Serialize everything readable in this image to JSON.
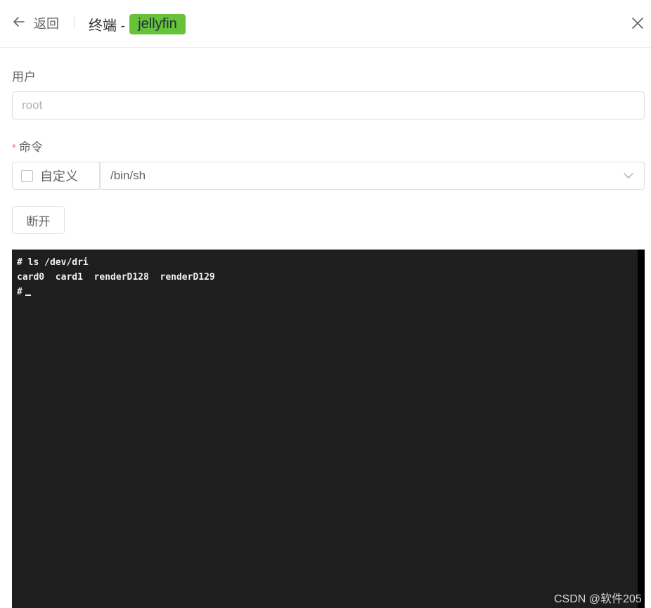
{
  "header": {
    "back_label": "返回",
    "title": "终端 -",
    "tag": "jellyfin",
    "tag_color": "#67c23a"
  },
  "form": {
    "user_label": "用户",
    "user_placeholder": "root",
    "user_value": "",
    "command_required_mark": "*",
    "command_label": "命令",
    "custom_checkbox_label": "自定义",
    "custom_checked": false,
    "command_selected": "/bin/sh",
    "disconnect_label": "断开"
  },
  "terminal": {
    "background": "#1e1e1e",
    "lines": [
      "# ls /dev/dri",
      "card0  card1  renderD128  renderD129",
      "#"
    ]
  },
  "watermark": "CSDN @软件205",
  "icons": {
    "back": "arrow-left-icon",
    "close": "close-icon",
    "select": "chevron-down-icon"
  }
}
